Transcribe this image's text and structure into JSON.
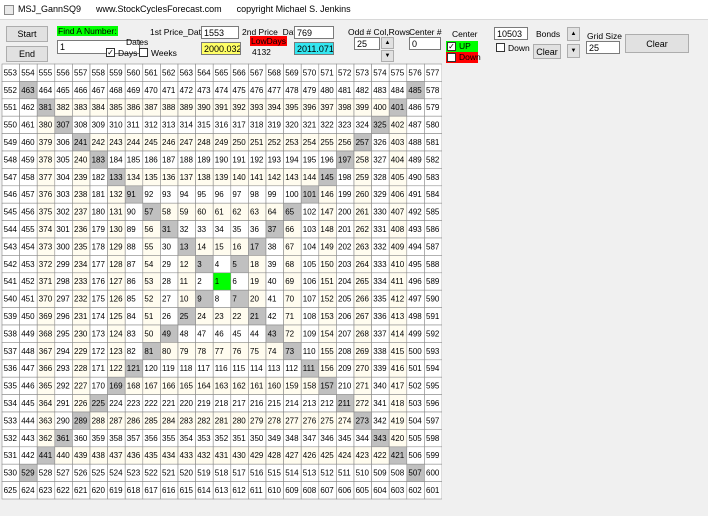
{
  "window": {
    "title": "MSJ_GannSQ9",
    "website": "www.StockCyclesForecast.com",
    "copyright": "copyright Michael S. Jenkins"
  },
  "toolbar": {
    "start_label": "Start",
    "end_label": "End",
    "find_label": "Find A Number:",
    "find_value": "1",
    "dates_label": "Dates",
    "days_label": "Days",
    "days_checked": true,
    "weeks_label": "Weeks",
    "weeks_checked": false,
    "price1_label": "1st Price_Date:",
    "price1_value": "1553",
    "price1_date": "2000.0324",
    "price2_label": "2nd Price_Date:",
    "price2_value": "769",
    "price2_date": "2011.0717",
    "lowdays_label": "LowDays",
    "lowdays_value": "4132",
    "oddcol_label": "Odd # Col,Rows",
    "oddcol_value": "25",
    "centernum_label": "Center #",
    "centernum_value": "0",
    "center_label": "Center",
    "up_label": "UP",
    "up_checked": true,
    "down_label": "Down",
    "bonds_value": "10503",
    "bonds_label": "Bonds",
    "down2_label": "Down",
    "down2_checked": false,
    "clear_small_label": "Clear",
    "gridsize_label": "Grid Size",
    "gridsize_value": "25",
    "clear_label": "Clear"
  },
  "colors": {
    "grid_gray": "#c0c0c0",
    "grid_cream": "#fffcef",
    "grid_white": "#ffffff",
    "center_green": "#00ff00",
    "date1_bg": "#ffff66",
    "date2_bg": "#33e6f0",
    "lowdays_bg": "#ff0000",
    "find_bg": "#00ff00",
    "up_bg": "#00ff00",
    "down_bg": "#ff0000"
  },
  "grid": {
    "rows": [
      [
        553,
        554,
        555,
        556,
        557,
        558,
        559,
        560,
        561,
        562,
        563,
        564,
        565,
        566,
        567,
        568,
        569,
        570,
        571,
        572,
        573,
        574,
        575,
        576,
        577
      ],
      [
        552,
        463,
        464,
        465,
        466,
        467,
        468,
        469,
        470,
        471,
        472,
        473,
        474,
        475,
        476,
        477,
        478,
        479,
        480,
        481,
        482,
        483,
        484,
        485,
        578
      ],
      [
        551,
        462,
        381,
        382,
        383,
        384,
        385,
        386,
        387,
        388,
        389,
        390,
        391,
        392,
        393,
        394,
        395,
        396,
        397,
        398,
        399,
        400,
        401,
        486,
        579
      ],
      [
        550,
        461,
        380,
        307,
        308,
        309,
        310,
        311,
        312,
        313,
        314,
        315,
        316,
        317,
        318,
        319,
        320,
        321,
        322,
        323,
        324,
        325,
        402,
        487,
        580
      ],
      [
        549,
        460,
        379,
        306,
        241,
        242,
        243,
        244,
        245,
        246,
        247,
        248,
        249,
        250,
        251,
        252,
        253,
        254,
        255,
        256,
        257,
        326,
        403,
        488,
        581
      ],
      [
        548,
        459,
        378,
        305,
        240,
        183,
        184,
        185,
        186,
        187,
        188,
        189,
        190,
        191,
        192,
        193,
        194,
        195,
        196,
        197,
        258,
        327,
        404,
        489,
        582
      ],
      [
        547,
        458,
        377,
        304,
        239,
        182,
        133,
        134,
        135,
        136,
        137,
        138,
        139,
        140,
        141,
        142,
        143,
        144,
        145,
        198,
        259,
        328,
        405,
        490,
        583
      ],
      [
        546,
        457,
        376,
        303,
        238,
        181,
        132,
        91,
        92,
        93,
        94,
        95,
        96,
        97,
        98,
        99,
        100,
        101,
        146,
        199,
        260,
        329,
        406,
        491,
        584
      ],
      [
        545,
        456,
        375,
        302,
        237,
        180,
        131,
        90,
        57,
        58,
        59,
        60,
        61,
        62,
        63,
        64,
        65,
        102,
        147,
        200,
        261,
        330,
        407,
        492,
        585
      ],
      [
        544,
        455,
        374,
        301,
        236,
        179,
        130,
        89,
        56,
        31,
        32,
        33,
        34,
        35,
        36,
        37,
        66,
        103,
        148,
        201,
        262,
        331,
        408,
        493,
        586
      ],
      [
        543,
        454,
        373,
        300,
        235,
        178,
        129,
        88,
        55,
        30,
        13,
        14,
        15,
        16,
        17,
        38,
        67,
        104,
        149,
        202,
        263,
        332,
        409,
        494,
        587
      ],
      [
        542,
        453,
        372,
        299,
        234,
        177,
        128,
        87,
        54,
        29,
        12,
        3,
        4,
        5,
        18,
        39,
        68,
        105,
        150,
        203,
        264,
        333,
        410,
        495,
        588
      ],
      [
        541,
        452,
        371,
        298,
        233,
        176,
        127,
        86,
        53,
        28,
        11,
        2,
        1,
        6,
        19,
        40,
        69,
        106,
        151,
        204,
        265,
        334,
        411,
        496,
        589
      ],
      [
        540,
        451,
        370,
        297,
        232,
        175,
        126,
        85,
        52,
        27,
        10,
        9,
        8,
        7,
        20,
        41,
        70,
        107,
        152,
        205,
        266,
        335,
        412,
        497,
        590
      ],
      [
        539,
        450,
        369,
        296,
        231,
        174,
        125,
        84,
        51,
        26,
        25,
        24,
        23,
        22,
        21,
        42,
        71,
        108,
        153,
        206,
        267,
        336,
        413,
        498,
        591
      ],
      [
        538,
        449,
        368,
        295,
        230,
        173,
        124,
        83,
        50,
        49,
        48,
        47,
        46,
        45,
        44,
        43,
        72,
        109,
        154,
        207,
        268,
        337,
        414,
        499,
        592
      ],
      [
        537,
        448,
        367,
        294,
        229,
        172,
        123,
        82,
        81,
        80,
        79,
        78,
        77,
        76,
        75,
        74,
        73,
        110,
        155,
        208,
        269,
        338,
        415,
        500,
        593
      ],
      [
        536,
        447,
        366,
        293,
        228,
        171,
        122,
        121,
        120,
        119,
        118,
        117,
        116,
        115,
        114,
        113,
        112,
        111,
        156,
        209,
        270,
        339,
        416,
        501,
        594
      ],
      [
        535,
        446,
        365,
        292,
        227,
        170,
        169,
        168,
        167,
        166,
        165,
        164,
        163,
        162,
        161,
        160,
        159,
        158,
        157,
        210,
        271,
        340,
        417,
        502,
        595
      ],
      [
        534,
        445,
        364,
        291,
        226,
        225,
        224,
        223,
        222,
        221,
        220,
        219,
        218,
        217,
        216,
        215,
        214,
        213,
        212,
        211,
        272,
        341,
        418,
        503,
        596
      ],
      [
        533,
        444,
        363,
        290,
        289,
        288,
        287,
        286,
        285,
        284,
        283,
        282,
        281,
        280,
        279,
        278,
        277,
        276,
        275,
        274,
        273,
        342,
        419,
        504,
        597
      ],
      [
        532,
        443,
        362,
        361,
        360,
        359,
        358,
        357,
        356,
        355,
        354,
        353,
        352,
        351,
        350,
        349,
        348,
        347,
        346,
        345,
        344,
        343,
        420,
        505,
        598
      ],
      [
        531,
        442,
        441,
        440,
        439,
        438,
        437,
        436,
        435,
        434,
        433,
        432,
        431,
        430,
        429,
        428,
        427,
        426,
        425,
        424,
        423,
        422,
        421,
        506,
        599
      ],
      [
        530,
        529,
        528,
        527,
        526,
        525,
        524,
        523,
        522,
        521,
        520,
        519,
        518,
        517,
        516,
        515,
        514,
        513,
        512,
        511,
        510,
        509,
        508,
        507,
        600
      ],
      [
        625,
        624,
        623,
        622,
        621,
        620,
        619,
        618,
        617,
        616,
        615,
        614,
        613,
        612,
        611,
        610,
        609,
        608,
        607,
        606,
        605,
        604,
        603,
        602,
        601
      ]
    ]
  }
}
